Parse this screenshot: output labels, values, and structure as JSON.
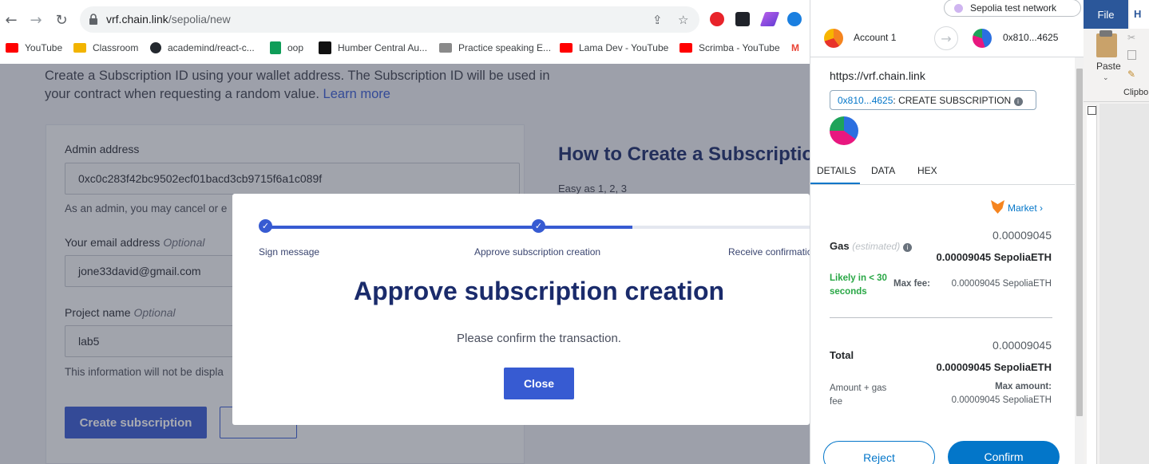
{
  "browser": {
    "url_host": "vrf.chain.link",
    "url_path": "/sepolia/new",
    "bookmarks": [
      {
        "label": "YouTube",
        "color": "#ff0000"
      },
      {
        "label": "Classroom",
        "color": "#f2b400"
      },
      {
        "label": "academind/react-c...",
        "color": "#24292f"
      },
      {
        "label": "oop",
        "color": "#0f9d58"
      },
      {
        "label": "Humber Central Au...",
        "color": "#111111"
      },
      {
        "label": "Practice speaking E...",
        "color": "#8a8a8a"
      },
      {
        "label": "Lama Dev - YouTube",
        "color": "#ff0000"
      },
      {
        "label": "Scrimba - YouTube",
        "color": "#ff0000"
      },
      {
        "label": "M",
        "color": "#ea4335"
      }
    ]
  },
  "page": {
    "intro_line1": "Create a Subscription ID using your wallet address. The Subscription ID will be used in",
    "intro_line2": "your contract when requesting a random value.",
    "learn_more": "Learn more",
    "admin_label": "Admin address",
    "admin_value": "0xc0c283f42bc9502ecf01bacd3cb9715f6a1c089f",
    "admin_hint": "As an admin, you may cancel or e",
    "email_label": "Your email address",
    "email_optional": "Optional",
    "email_value": "jone33david@gmail.com",
    "project_label": "Project name",
    "project_optional": "Optional",
    "project_value": "lab5",
    "info_hint": "This information will not be displa",
    "create_button": "Create subscription",
    "how_title": "How to Create a Subscription",
    "easy": "Easy as 1, 2, 3"
  },
  "modal": {
    "steps": [
      "Sign message",
      "Approve subscription creation",
      "Receive confirmation"
    ],
    "title": "Approve subscription creation",
    "subtitle": "Please confirm the transaction.",
    "close_button": "Close"
  },
  "metamask": {
    "network": "Sepolia test network",
    "account_name": "Account 1",
    "to_address": "0x810...4625",
    "origin": "https://vrf.chain.link",
    "method_address": "0x810...4625",
    "method_name": ": CREATE SUBSCRIPTION",
    "tabs": [
      "DETAILS",
      "DATA",
      "HEX"
    ],
    "market": "Market",
    "gas_label": "Gas",
    "gas_estimated": "(estimated)",
    "gas_value": "0.00009045",
    "gas_value_eth": "0.00009045 SepoliaETH",
    "likely_line1": "Likely in < 30",
    "likely_line2": "seconds",
    "max_fee_label": "Max fee:",
    "max_fee_value": "0.00009045 SepoliaETH",
    "total_label": "Total",
    "total_value": "0.00009045",
    "total_value_eth": "0.00009045 SepoliaETH",
    "amount_gas_line1": "Amount + gas",
    "amount_gas_line2": "fee",
    "max_amount_label": "Max amount:",
    "max_amount_value": "0.00009045 SepoliaETH",
    "reject_button": "Reject",
    "confirm_button": "Confirm"
  },
  "word": {
    "file_tab": "File",
    "home_tab": "H",
    "paste": "Paste",
    "clipboard": "Clipbo"
  }
}
